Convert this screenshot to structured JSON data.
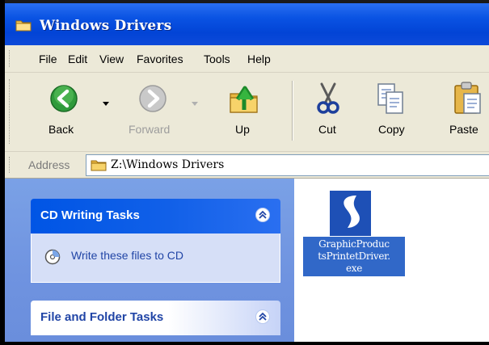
{
  "window": {
    "title": "Windows Drivers"
  },
  "menu": [
    "File",
    "Edit",
    "View",
    "Favorites",
    "Tools",
    "Help"
  ],
  "toolbar": {
    "back": "Back",
    "forward": "Forward",
    "up": "Up",
    "cut": "Cut",
    "copy": "Copy",
    "paste": "Paste"
  },
  "address": {
    "label": "Address",
    "path": "Z:\\Windows Drivers"
  },
  "taskpane": {
    "cd_panel": {
      "title": "CD Writing Tasks",
      "task": "Write these files to CD"
    },
    "folder_panel": {
      "title": "File and Folder Tasks"
    }
  },
  "files": [
    {
      "name_lines": [
        "GraphicProduc",
        "tsPrintetDriver.",
        "exe"
      ],
      "icon": "installer-icon"
    }
  ],
  "colors": {
    "titlebar": "#0a53e3",
    "chrome": "#ece9d8",
    "taskpane": "#6f93e0",
    "selection": "#3168c8"
  }
}
